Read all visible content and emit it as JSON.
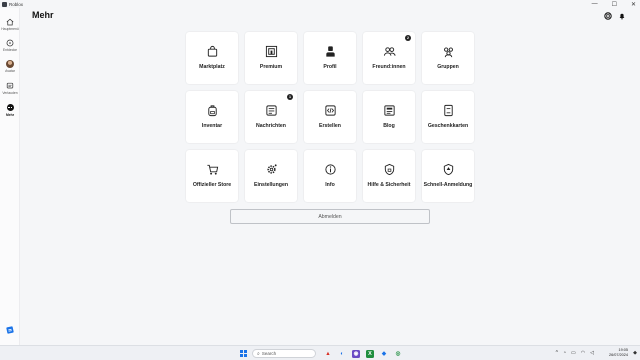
{
  "window": {
    "title": "Roblox",
    "controls": {
      "minimize": "—",
      "maximize": "☐",
      "close": "✕"
    }
  },
  "sidebar": {
    "items": [
      {
        "label": "Hauptmenü",
        "icon": "home-icon"
      },
      {
        "label": "Entdecke",
        "icon": "compass-icon"
      },
      {
        "label": "Avatar",
        "icon": "avatar-icon"
      },
      {
        "label": "Verlauden",
        "icon": "chat-icon"
      },
      {
        "label": "Mehr",
        "icon": "more-icon",
        "active": true
      }
    ]
  },
  "header": {
    "title": "Mehr",
    "icons": [
      "robux-icon",
      "notifications-icon"
    ]
  },
  "tiles": [
    {
      "label": "Marktplatz",
      "icon": "shopping-bag-icon"
    },
    {
      "label": "Premium",
      "icon": "premium-icon"
    },
    {
      "label": "Profil",
      "icon": "profile-icon"
    },
    {
      "label": "Freund:innen",
      "icon": "friends-icon",
      "badge": "2"
    },
    {
      "label": "Gruppen",
      "icon": "groups-icon"
    },
    {
      "label": "Inventar",
      "icon": "backpack-icon"
    },
    {
      "label": "Nachrichten",
      "icon": "messages-icon",
      "badge": "1"
    },
    {
      "label": "Erstellen",
      "icon": "create-icon"
    },
    {
      "label": "Blog",
      "icon": "blog-icon"
    },
    {
      "label": "Geschenkkarten",
      "icon": "gift-card-icon"
    },
    {
      "label": "Offizieller Store",
      "icon": "cart-icon"
    },
    {
      "label": "Einstellungen",
      "icon": "settings-icon"
    },
    {
      "label": "Info",
      "icon": "info-icon"
    },
    {
      "label": "Hilfe & Sicherheit",
      "icon": "safety-icon"
    },
    {
      "label": "Schnell-Anmeldung",
      "icon": "quick-login-icon"
    }
  ],
  "logout": {
    "label": "Abmelden"
  },
  "taskbar": {
    "search_placeholder": "Search",
    "time": "19:05",
    "date": "26/07/2024"
  },
  "colors": {
    "accent": "#1a73e8",
    "background": "#f5f6f8",
    "tile": "#ffffff"
  }
}
